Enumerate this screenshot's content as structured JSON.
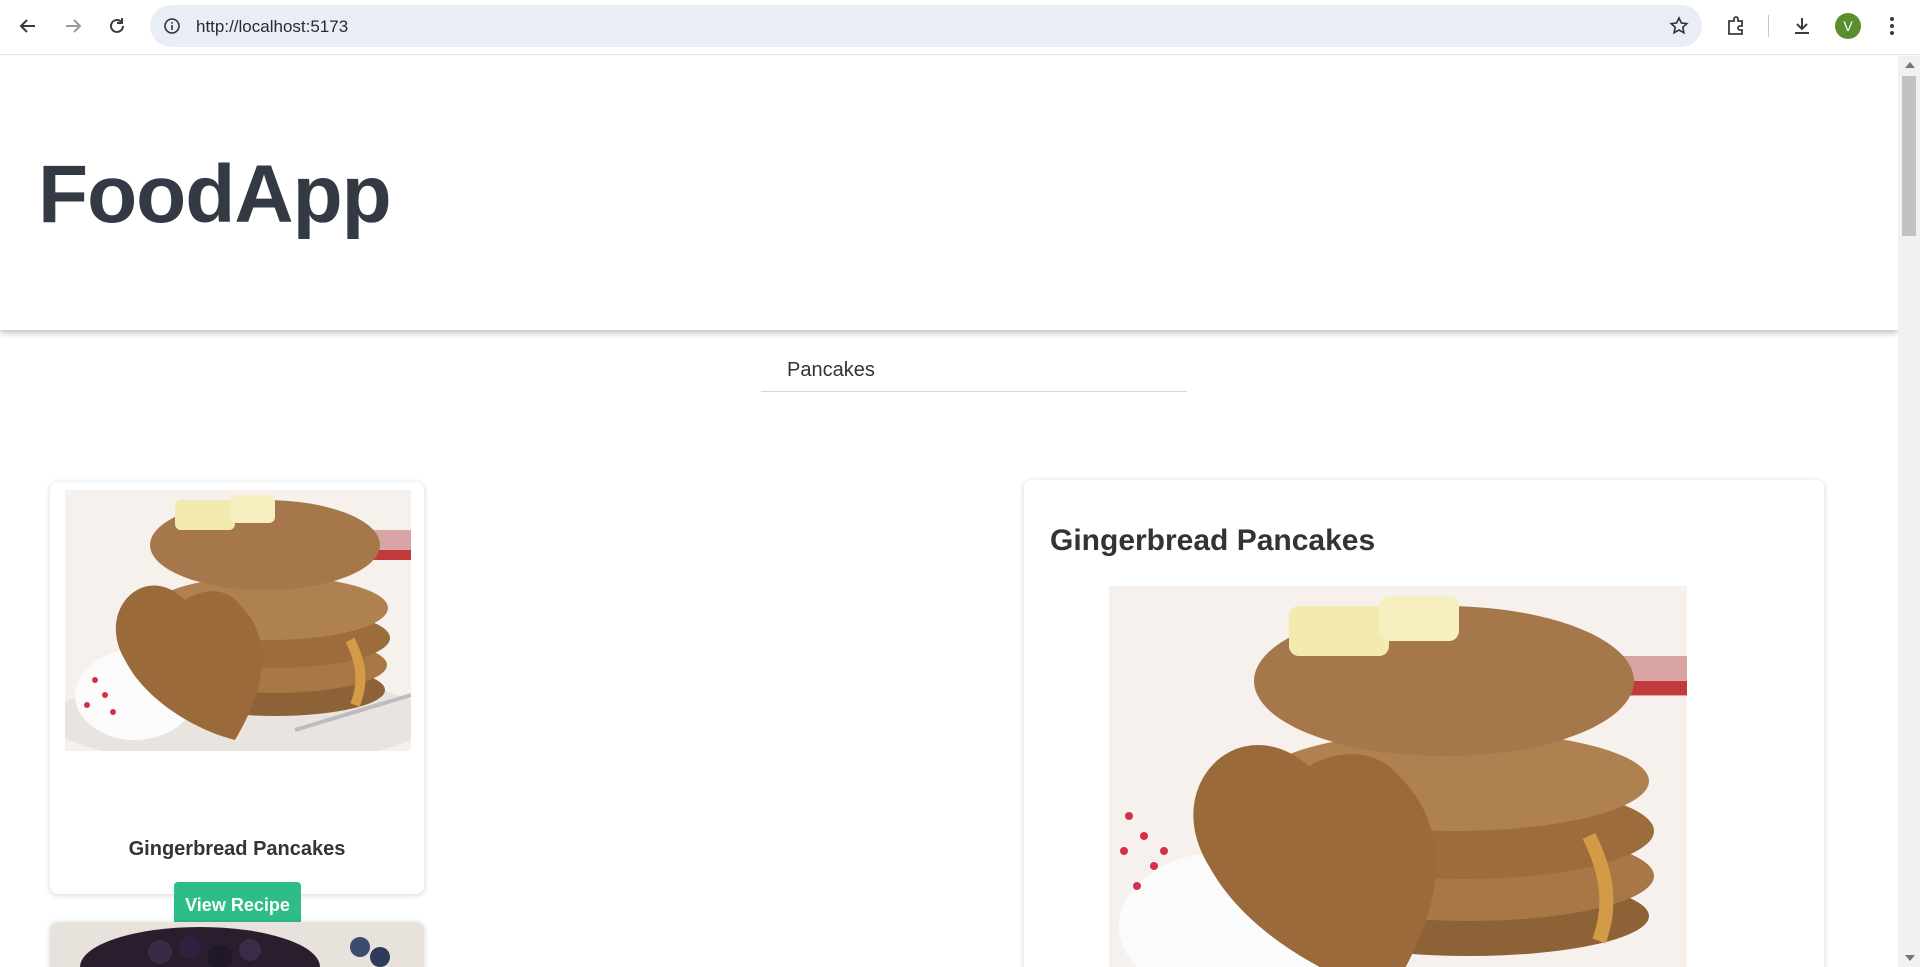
{
  "browser": {
    "url": "http://localhost:5173",
    "avatar_letter": "V"
  },
  "app": {
    "title": "FoodApp"
  },
  "search": {
    "value": "Pancakes"
  },
  "results": [
    {
      "title": "Gingerbread Pancakes",
      "button_label": "View Recipe"
    }
  ],
  "detail": {
    "title": "Gingerbread Pancakes"
  },
  "colors": {
    "accent": "#2ebd88",
    "title": "#333a44",
    "avatar": "#5a8f2f"
  }
}
